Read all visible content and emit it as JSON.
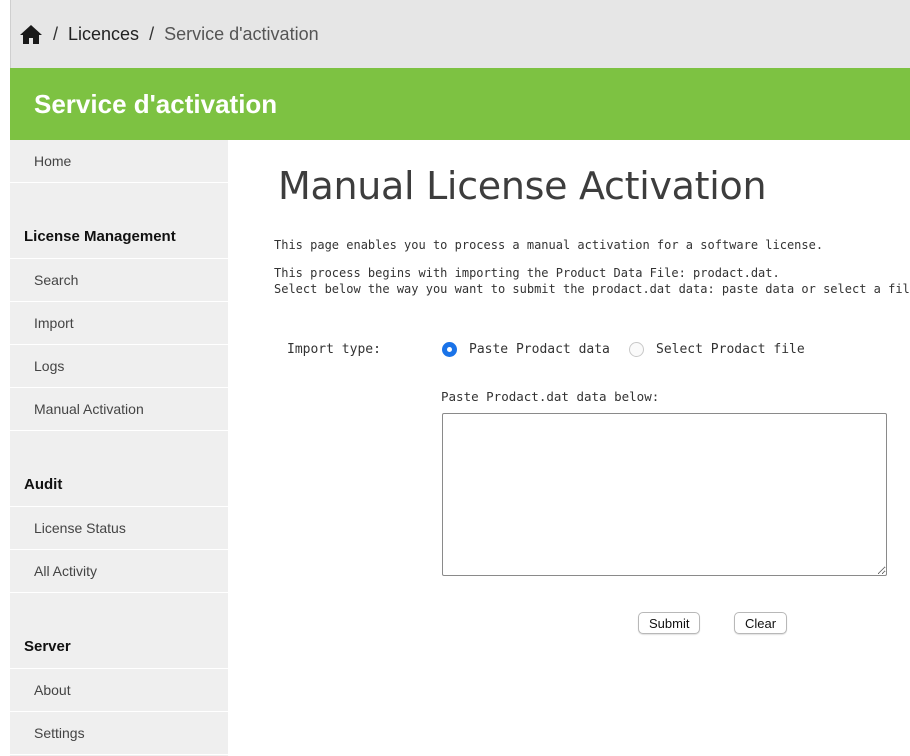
{
  "breadcrumb": {
    "home_icon": "home-icon",
    "separator": "/",
    "licences": "Licences",
    "current": "Service d'activation"
  },
  "banner": {
    "title": "Service d'activation"
  },
  "colors": {
    "banner": "#7dc242",
    "radio_selected": "#1a73e8",
    "sidebar": "#efefef"
  },
  "sidebar": {
    "home": "Home",
    "sections": [
      {
        "title": "License Management",
        "items": [
          "Search",
          "Import",
          "Logs",
          "Manual Activation"
        ]
      },
      {
        "title": "Audit",
        "items": [
          "License Status",
          "All Activity"
        ]
      },
      {
        "title": "Server",
        "items": [
          "About",
          "Settings"
        ]
      }
    ]
  },
  "main": {
    "title": "Manual License Activation",
    "intro_line1": "This page enables you to process a manual activation for a software license.",
    "intro_line2": "This process begins with importing the Product Data File: prodact.dat.",
    "intro_line3": "Select below the way you want to submit the prodact.dat data: paste data or select a file.",
    "import_type_label": "Import type:",
    "radio_paste": {
      "label": "Paste Prodact data",
      "selected": true
    },
    "radio_file": {
      "label": "Select Prodact file",
      "selected": false
    },
    "paste_label": "Paste Prodact.dat data below:",
    "paste_value": "",
    "submit_label": "Submit",
    "clear_label": "Clear"
  }
}
